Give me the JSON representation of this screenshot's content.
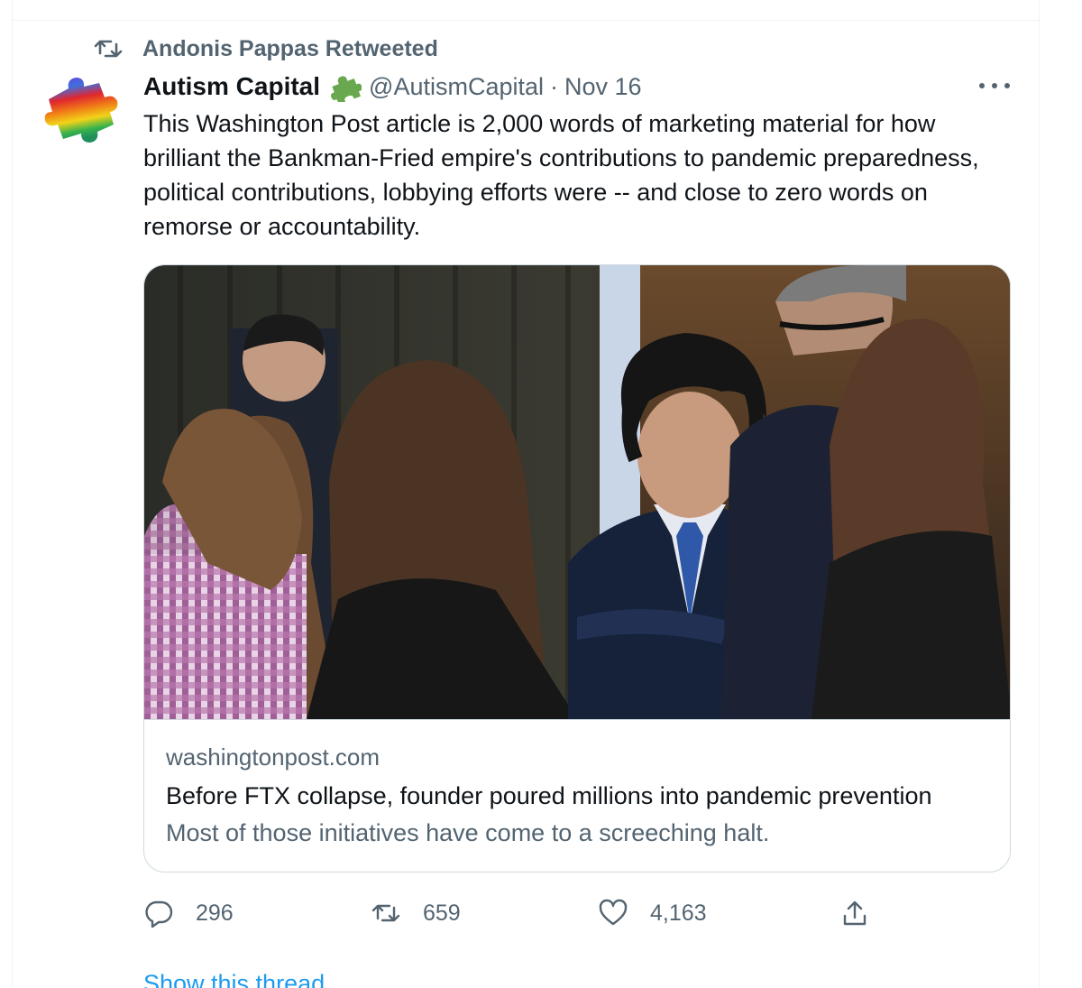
{
  "retweet": {
    "icon": "retweet-icon",
    "text": "Andonis Pappas Retweeted"
  },
  "author": {
    "name": "Autism Capital",
    "badge_icon": "puzzle-piece-icon",
    "handle": "@AutismCapital",
    "separator": "·",
    "date": "Nov 16",
    "avatar_icon": "rainbow-puzzle-avatar"
  },
  "tweet": {
    "text": "This Washington Post article is 2,000 words of marketing material for how brilliant the Bankman-Fried empire's contributions to pandemic preparedness, political contributions, lobbying efforts were -- and close to zero words on remorse or accountability."
  },
  "link_card": {
    "domain": "washingtonpost.com",
    "title": "Before FTX collapse, founder poured millions into pandemic prevention",
    "description": "Most of those initiatives have come to a screeching halt."
  },
  "actions": {
    "reply": {
      "icon": "reply-icon",
      "count": "296"
    },
    "retweet": {
      "icon": "retweet-icon",
      "count": "659"
    },
    "like": {
      "icon": "heart-icon",
      "count": "4,163"
    },
    "share": {
      "icon": "share-icon"
    }
  },
  "footer": {
    "show_thread": "Show this thread"
  },
  "colors": {
    "text_primary": "#0f1419",
    "text_secondary": "#536471",
    "link_blue": "#1d9bf0",
    "border": "#cfd9de",
    "badge_green": "#6aa84f"
  }
}
